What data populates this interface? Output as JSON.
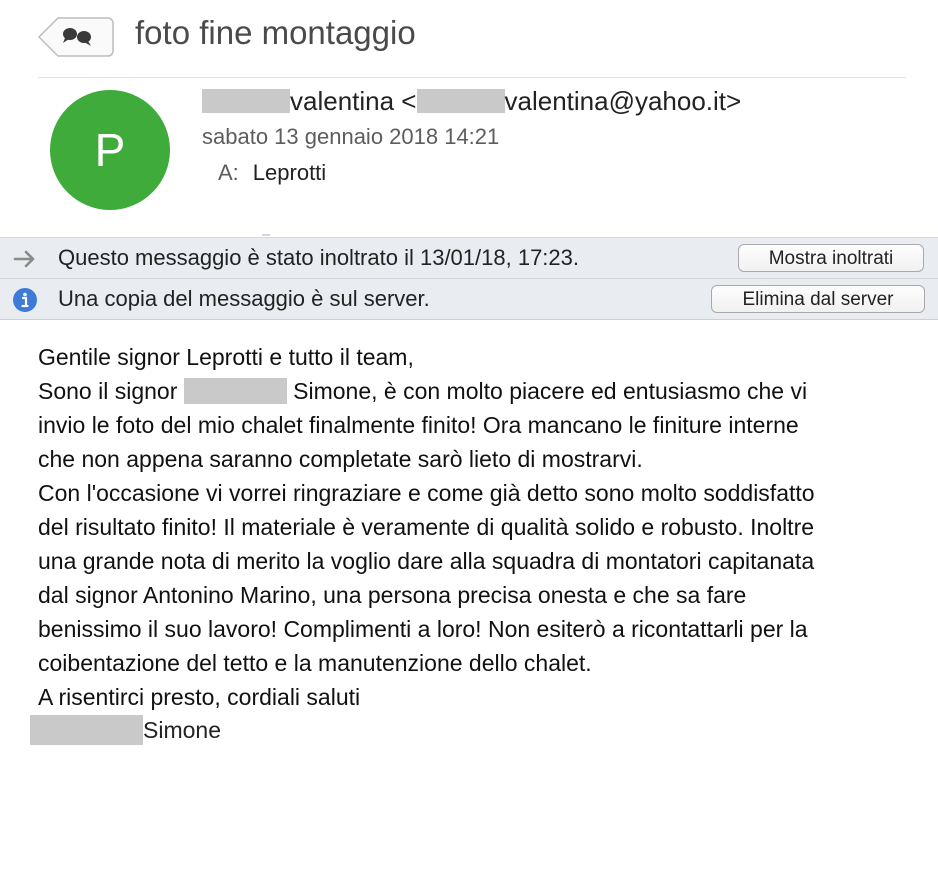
{
  "header": {
    "subject": "foto fine montaggio",
    "back_icon": "conversation-bubbles-icon"
  },
  "sender": {
    "avatar_initial": "P",
    "avatar_color": "#3fab3a",
    "name": "valentina",
    "email_visible": "valentina@yahoo.it>",
    "email_prefix": " <",
    "date": "sabato 13 gennaio 2018 14:21",
    "to_label": "A:",
    "to_value": "Leprotti"
  },
  "notices": [
    {
      "icon": "forward-arrow-icon",
      "text": "Questo messaggio è stato inoltrato il 13/01/18, 17:23.",
      "button": "Mostra inoltrati"
    },
    {
      "icon": "info-icon",
      "text": "Una copia del messaggio è sul server.",
      "button": "Elimina dal server"
    }
  ],
  "body": {
    "line1": "Gentile signor Leprotti e tutto il team,",
    "line2_pre": "Sono il signor ",
    "line2_post": " Simone, è con molto piacere ed entusiasmo che vi",
    "line3": "invio le foto del mio chalet finalmente finito! Ora mancano le finiture interne",
    "line4": "che non appena saranno completate sarò lieto di mostrarvi.",
    "line5": "Con l'occasione vi vorrei ringraziare e come già detto sono molto soddisfatto",
    "line6": "del risultato finito! Il materiale è veramente di qualità solido e robusto. Inoltre",
    "line7": "una grande nota di merito la voglio dare alla squadra di montatori capitanata",
    "line8": "dal signor Antonino Marino, una persona precisa onesta e che sa fare",
    "line9": "benissimo il suo lavoro! Complimenti a loro! Non esiterò a ricontattarli per la",
    "line10": "coibentazione del tetto e la manutenzione dello chalet.",
    "line11": "A risentirci presto, cordiali saluti",
    "signature": "Simone"
  }
}
